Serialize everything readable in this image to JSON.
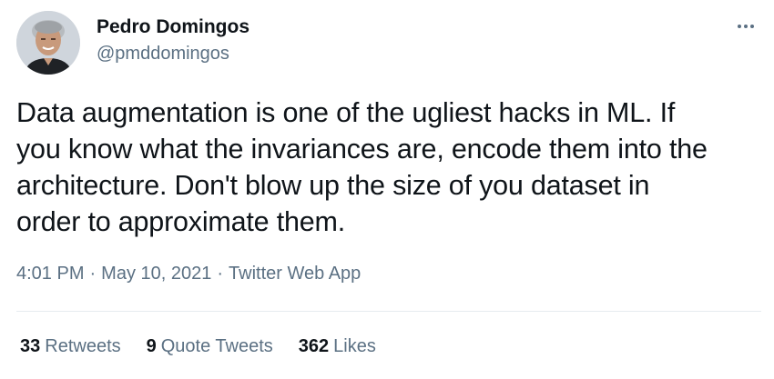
{
  "author": {
    "display_name": "Pedro Domingos",
    "handle": "@pmddomingos"
  },
  "tweet": {
    "lines": [
      "Data augmentation is one of the ugliest hacks in ML. If",
      "you know what the invariances are, encode them into the",
      "architecture. Don't blow up the size of you dataset in",
      "order to approximate them."
    ],
    "time": "4:01 PM",
    "date": "May 10, 2021",
    "source": "Twitter Web App",
    "separator": "·"
  },
  "stats": {
    "retweets": {
      "count": "33",
      "label": "Retweets"
    },
    "quote_tweets": {
      "count": "9",
      "label": "Quote Tweets"
    },
    "likes": {
      "count": "362",
      "label": "Likes"
    }
  },
  "icons": {
    "more": "more-options-icon",
    "avatar": "profile-photo"
  },
  "colors": {
    "text": "#0f1419",
    "secondary": "#5b7083",
    "divider": "#e6ecf0",
    "background": "#ffffff"
  }
}
